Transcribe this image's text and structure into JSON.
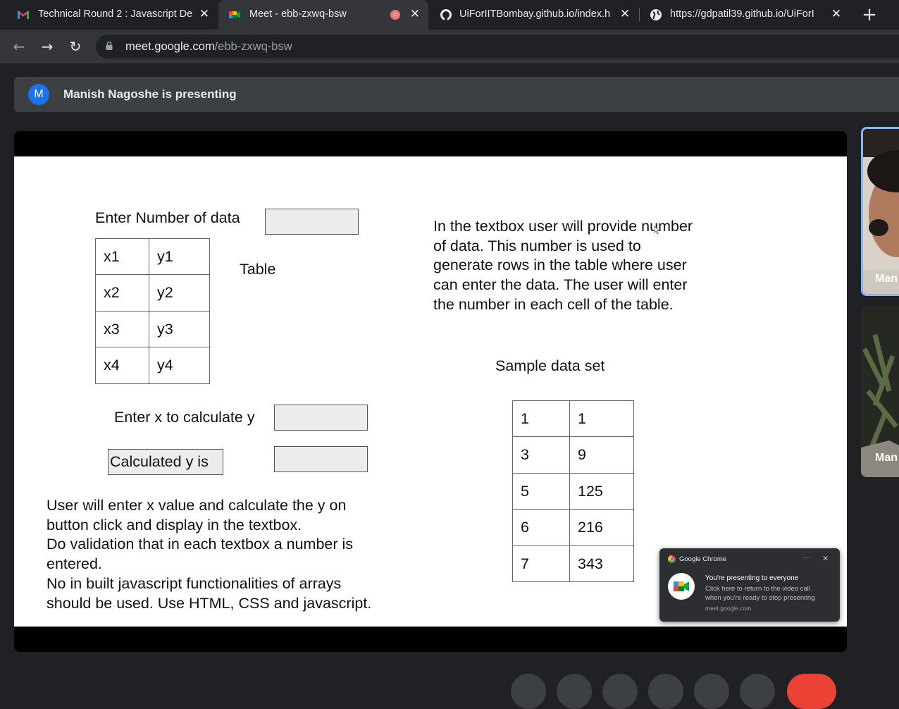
{
  "browser": {
    "tabs": [
      {
        "title": "Technical Round 2 : Javascript De",
        "icon": "gmail-icon"
      },
      {
        "title": "Meet - ebb-zxwq-bsw",
        "icon": "google-meet-icon",
        "recording": true
      },
      {
        "title": "UiForIITBombay.github.io/index.h",
        "icon": "github-icon"
      },
      {
        "title": "https://gdpatil39.github.io/UiForI",
        "icon": "globe-icon"
      }
    ],
    "url_host": "meet.google.com",
    "url_path": "/ebb-zxwq-bsw"
  },
  "meet": {
    "presenter_initial": "M",
    "presenting_text": "Manish Nagoshe is presenting",
    "participants": [
      {
        "name": "Man"
      },
      {
        "name": "Man"
      }
    ]
  },
  "slide": {
    "enter_number_label": "Enter Number of data",
    "input_table": [
      [
        "x1",
        "y1"
      ],
      [
        "x2",
        "y2"
      ],
      [
        "x3",
        "y3"
      ],
      [
        "x4",
        "y4"
      ]
    ],
    "table_label": "Table",
    "description_lines": [
      "In the textbox user will provide number",
      "of data. This number is used to",
      "generate rows in the table where user",
      "can enter the data. The user will enter",
      "the number in each cell of the table."
    ],
    "sample_title": "Sample data set",
    "sample_table": [
      [
        "1",
        "1"
      ],
      [
        "3",
        "9"
      ],
      [
        "5",
        "125"
      ],
      [
        "6",
        "216"
      ],
      [
        "7",
        "343"
      ]
    ],
    "enter_x_label": "Enter x to calculate y",
    "calculated_label": "Calculated y is",
    "instructions_lines": [
      "User will enter x value and calculate the y on",
      "button click and display in the textbox.",
      "Do validation that in each textbox a number is",
      "entered.",
      "No in built javascript functionalities of arrays",
      "should be used. Use HTML, CSS and javascript."
    ]
  },
  "notification": {
    "app": "Google Chrome",
    "title": "You're presenting to everyone",
    "body_lines": [
      "Click here to return to the video call",
      "when you're ready to stop presenting"
    ],
    "url": "meet.google.com"
  }
}
